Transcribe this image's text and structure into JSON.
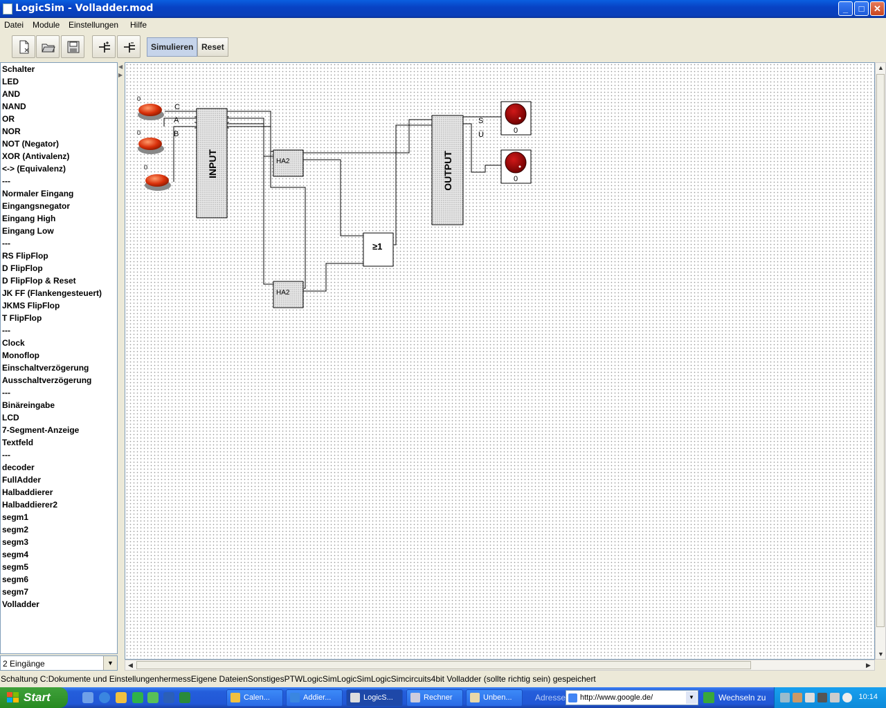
{
  "window": {
    "title": "LogicSim - Volladder.mod",
    "minimize_label": "_",
    "maximize_label": "□",
    "close_label": "✕"
  },
  "menu": [
    "Datei",
    "Module",
    "Einstellungen",
    "Hilfe"
  ],
  "toolbar": {
    "buttons": [
      "new-file-icon",
      "open-folder-icon",
      "save-disk-icon",
      "add-input-icon",
      "remove-input-icon"
    ],
    "simulate_label": "Simulieren",
    "reset_label": "Reset"
  },
  "sidebar": {
    "items": [
      "Schalter",
      "LED",
      "AND",
      "NAND",
      "OR",
      "NOR",
      "NOT (Negator)",
      "XOR (Antivalenz)",
      "<-> (Equivalenz)",
      "---",
      "Normaler Eingang",
      "Eingangsnegator",
      "Eingang High",
      "Eingang Low",
      "---",
      "RS FlipFlop",
      "D FlipFlop",
      "D FlipFlop & Reset",
      "JK FF (Flankengesteuert)",
      "JKMS FlipFlop",
      "T FlipFlop",
      "---",
      "Clock",
      "Monoflop",
      "Einschaltverzögerung",
      "Ausschaltverzögerung",
      "---",
      "Binäreingabe",
      "LCD",
      "7-Segment-Anzeige",
      "Textfeld",
      "---",
      "decoder",
      "FullAdder",
      "Halbaddierer",
      "Halbaddierer2",
      "segm1",
      "segm2",
      "segm3",
      "segm4",
      "segm5",
      "segm6",
      "segm7",
      "Volladder"
    ],
    "inputs_select": "2 Eingänge"
  },
  "circuit": {
    "switches": [
      {
        "value": "0"
      },
      {
        "value": "0"
      },
      {
        "value": "0"
      }
    ],
    "input_pins": [
      "C",
      "A",
      "B"
    ],
    "input_module": "INPUT",
    "output_module": "OUTPUT",
    "output_pins": [
      "S",
      "Ü"
    ],
    "half_adder_1": "HA2",
    "half_adder_2": "HA2",
    "or_gate": "≥1",
    "leds": [
      {
        "value": "0"
      },
      {
        "value": "0"
      }
    ]
  },
  "status": "Schaltung C:Dokumente und EinstellungenhermessEigene DateienSonstigesPTWLogicSimLogicSimLogicSimcircuits4bit Volladder (sollte richtig sein) gespeichert",
  "taskbar": {
    "start_label": "Start",
    "tasks": [
      "Calen...",
      "Addier...",
      "LogicS...",
      "Rechner",
      "Unben..."
    ],
    "address_label": "Adresse",
    "address_value": "http://www.google.de/",
    "go_label": "Wechseln zu",
    "clock": "10:14"
  }
}
